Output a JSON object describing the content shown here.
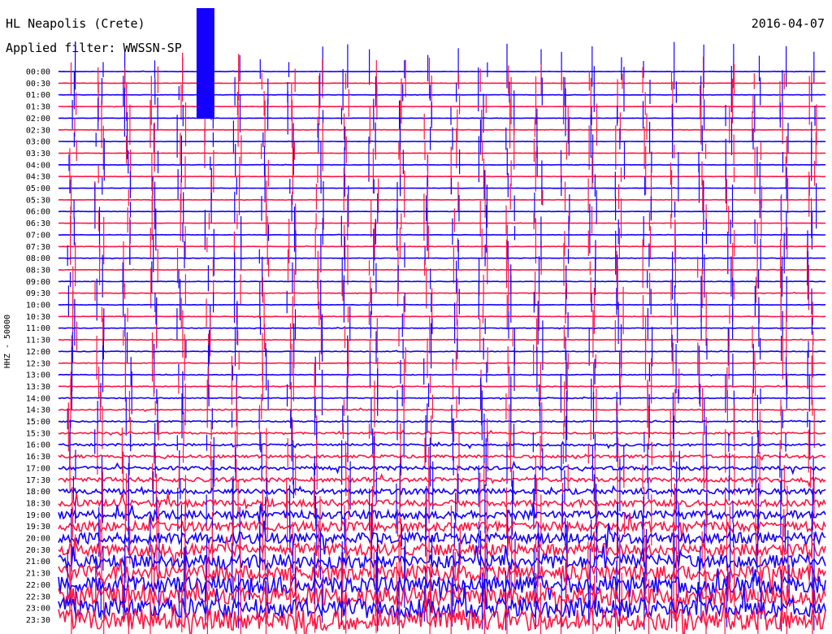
{
  "header": {
    "station": "HL Neapolis (Crete)",
    "filter": "Applied filter: WWSSN-SP",
    "date": "2016-04-07"
  },
  "chart_data": {
    "type": "line",
    "title": "HL Neapolis (Crete)",
    "subtitle": "Applied filter: WWSSN-SP",
    "date": "2016-04-07",
    "ylabel": "HHZ - 50000",
    "row_labels": [
      "00:00",
      "00:30",
      "01:00",
      "01:30",
      "02:00",
      "02:30",
      "03:00",
      "03:30",
      "04:00",
      "04:30",
      "05:00",
      "05:30",
      "06:00",
      "06:30",
      "07:00",
      "07:30",
      "08:00",
      "08:30",
      "09:00",
      "09:30",
      "10:00",
      "10:30",
      "11:00",
      "11:30",
      "12:00",
      "12:30",
      "13:00",
      "13:30",
      "14:00",
      "14:30",
      "15:00",
      "15:30",
      "16:00",
      "16:30",
      "17:00",
      "17:30",
      "18:00",
      "18:30",
      "19:00",
      "19:30",
      "20:00",
      "20:30",
      "21:00",
      "21:30",
      "22:00",
      "22:30",
      "23:00",
      "23:30"
    ],
    "row_colors": [
      "#1400ff",
      "#ff1744"
    ],
    "trace_x_range_minutes": [
      0,
      30
    ],
    "noise_level_relative": [
      0.04,
      0.04,
      0.04,
      0.04,
      0.04,
      0.04,
      0.04,
      0.04,
      0.04,
      0.04,
      0.04,
      0.04,
      0.04,
      0.04,
      0.05,
      0.05,
      0.06,
      0.06,
      0.06,
      0.06,
      0.06,
      0.06,
      0.07,
      0.07,
      0.08,
      0.08,
      0.09,
      0.1,
      0.12,
      0.14,
      0.18,
      0.22,
      0.3,
      0.38,
      0.5,
      0.6,
      0.75,
      0.9,
      1.1,
      1.3,
      1.5,
      1.7,
      1.9,
      2.1,
      2.3,
      2.5,
      2.7,
      2.9
    ],
    "events": [
      {
        "row": 0,
        "x_minutes": 5.4,
        "amplitude": 5.5,
        "type": "saturated_burst",
        "duration_minutes": 0.7,
        "rows_spanned": 4
      }
    ],
    "grid": false,
    "legend": "none"
  }
}
